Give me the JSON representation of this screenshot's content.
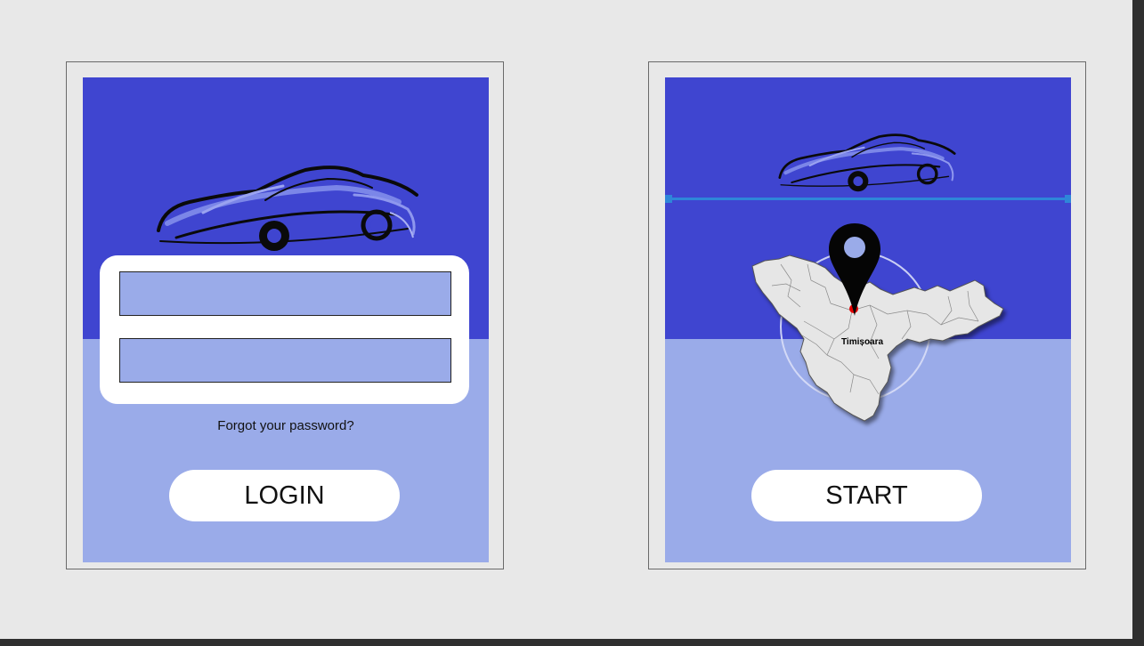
{
  "login_screen": {
    "username_value": "",
    "password_value": "",
    "forgot_link": "Forgot your password?",
    "login_button": "LOGIN"
  },
  "start_screen": {
    "city_label": "Timișoara",
    "start_button": "START"
  },
  "icons": {
    "car": "car-silhouette-icon",
    "pin": "map-pin-icon"
  },
  "colors": {
    "top_band": "#3f45d0",
    "bottom_band": "#9aabe9",
    "selection": "#2e86d9"
  }
}
